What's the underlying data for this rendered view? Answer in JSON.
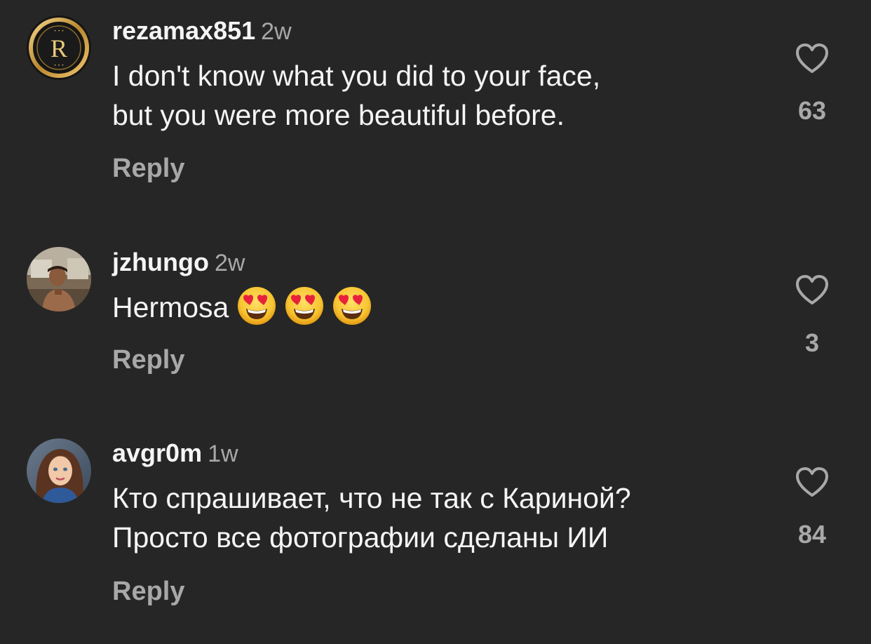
{
  "colors": {
    "background": "#262626",
    "primary_text": "#f5f5f5",
    "secondary_text": "#a8a8a8"
  },
  "comments": [
    {
      "username": "rezamax851",
      "time": "2w",
      "lines": [
        "I don't know what you did to your face,",
        "but you were more beautiful before."
      ],
      "reply_label": "Reply",
      "likes": "63",
      "avatar": "gold-r-logo"
    },
    {
      "username": "jzhungo",
      "time": "2w",
      "lines": [
        "Hermosa"
      ],
      "emojis": [
        "heart-eyes-emoji",
        "heart-eyes-emoji",
        "heart-eyes-emoji"
      ],
      "reply_label": "Reply",
      "likes": "3",
      "avatar": "person-photo"
    },
    {
      "username": "avgr0m",
      "time": "1w",
      "lines": [
        "Кто спрашивает, что не так с Кариной?",
        "Просто все фотографии сделаны ИИ"
      ],
      "reply_label": "Reply",
      "likes": "84",
      "avatar": "illustrated-woman"
    }
  ]
}
